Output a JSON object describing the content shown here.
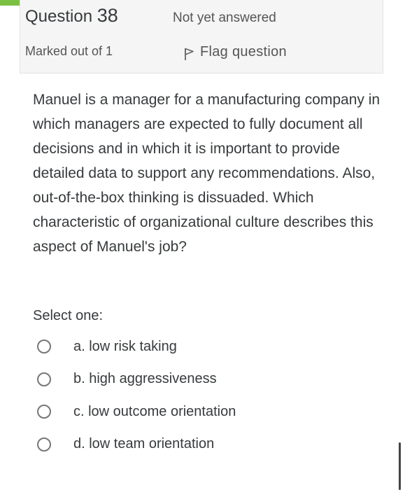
{
  "question": {
    "label": "Question",
    "number": "38",
    "state": "Not yet answered",
    "grade": "Marked out of 1",
    "flag_label": "Flag question",
    "text": "Manuel is a manager for a manufacturing company in which managers are expected to fully document all decisions and in which it is important to provide detailed data to support any recommendations. Also, out-of-the-box thinking is dissuaded. Which characteristic of organizational culture describes this aspect of Manuel's job?",
    "prompt": "Select one:",
    "answers": [
      {
        "label": "a. low risk taking"
      },
      {
        "label": "b. high aggressiveness"
      },
      {
        "label": "c. low outcome orientation"
      },
      {
        "label": "d. low team orientation"
      }
    ]
  },
  "icons": {
    "flag": "flag-icon",
    "radio": "radio-unchecked-icon"
  },
  "colors": {
    "accent_tab": "#7bc043",
    "info_background": "#f5f5f5",
    "text": "#373a3c"
  }
}
